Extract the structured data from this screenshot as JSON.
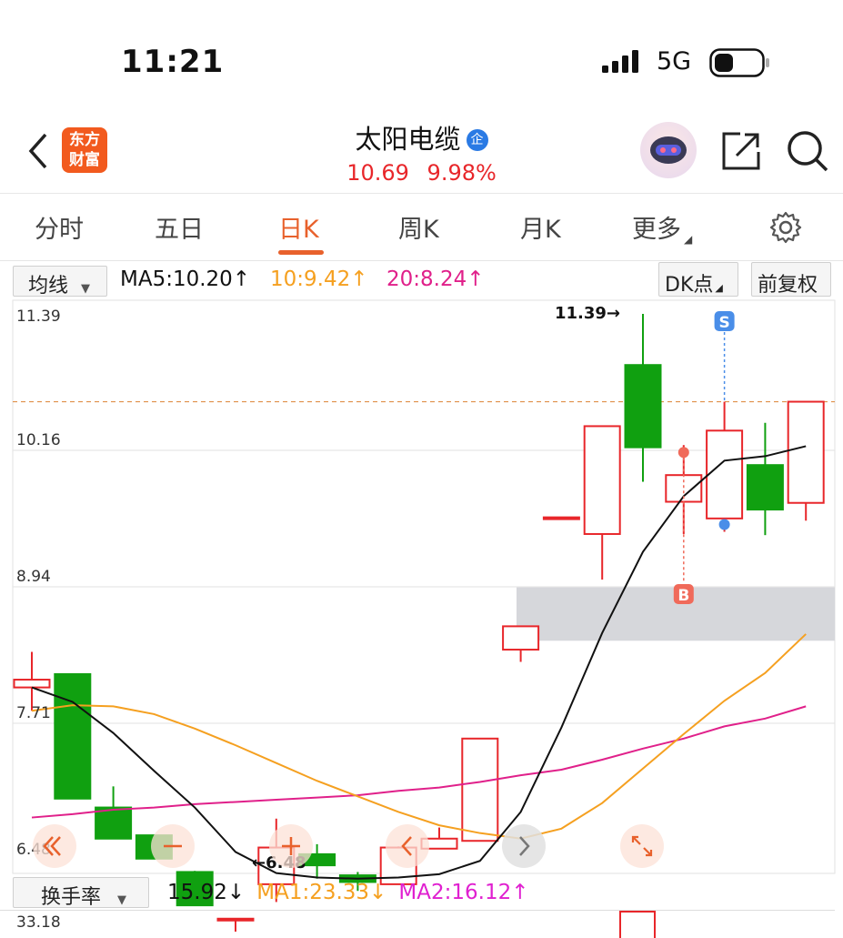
{
  "status": {
    "time": "11:21",
    "network": "5G"
  },
  "header": {
    "logo": [
      "东方",
      "财富"
    ],
    "title": "太阳电缆",
    "title_badge": "企",
    "price": "10.69",
    "change": "9.98%"
  },
  "tabs": [
    {
      "label": "分时"
    },
    {
      "label": "五日"
    },
    {
      "label": "日K",
      "active": true
    },
    {
      "label": "周K"
    },
    {
      "label": "月K"
    },
    {
      "label": "更多"
    }
  ],
  "indicator_bar": {
    "selector": "均线",
    "ma5": "MA5:10.20",
    "ma10": "10:9.42",
    "ma20": "20:8.24",
    "dk_button": "DK点",
    "adjust_button": "前复权"
  },
  "colors": {
    "up": "#e8262a",
    "down": "#10a010",
    "ma5": "#111111",
    "ma10": "#f5a020",
    "ma20": "#e0208a",
    "accent": "#e8612c"
  },
  "chart_data": {
    "type": "candlestick",
    "y_ticks": [
      "11.39",
      "10.16",
      "8.94",
      "7.71",
      "6.48"
    ],
    "ylim": [
      6.48,
      11.39
    ],
    "max_label": "11.39→",
    "min_label": "←6.48",
    "reference_line": 10.6,
    "support_zone": [
      8.45,
      8.93
    ],
    "candles": [
      {
        "o": 8.03,
        "c": 8.1,
        "h": 8.35,
        "l": 7.82
      },
      {
        "o": 8.15,
        "c": 7.03,
        "h": 8.15,
        "l": 7.03
      },
      {
        "o": 6.95,
        "c": 6.67,
        "h": 7.14,
        "l": 6.67
      },
      {
        "o": 6.7,
        "c": 6.49,
        "h": 6.7,
        "l": 6.49
      },
      {
        "o": 6.37,
        "c": 6.07,
        "h": 6.38,
        "l": 6.07
      },
      {
        "o": 5.95,
        "c": 5.95,
        "h": 5.95,
        "l": 5.78
      },
      {
        "o": 6.26,
        "c": 6.59,
        "h": 6.85,
        "l": 6.1
      },
      {
        "o": 6.53,
        "c": 6.43,
        "h": 6.62,
        "l": 6.31
      },
      {
        "o": 6.34,
        "c": 6.28,
        "h": 6.37,
        "l": 6.2
      },
      {
        "o": 6.26,
        "c": 6.59,
        "h": 6.6,
        "l": 6.26
      },
      {
        "o": 6.58,
        "c": 6.67,
        "h": 6.77,
        "l": 6.58
      },
      {
        "o": 6.65,
        "c": 7.57,
        "h": 7.57,
        "l": 6.65
      },
      {
        "o": 8.37,
        "c": 8.58,
        "h": 8.58,
        "l": 8.26
      },
      {
        "o": 9.56,
        "c": 9.56,
        "h": 9.56,
        "l": 9.56
      },
      {
        "o": 9.41,
        "c": 10.38,
        "h": 10.38,
        "l": 9.0
      },
      {
        "o": 10.93,
        "c": 10.19,
        "h": 11.39,
        "l": 9.88
      },
      {
        "o": 9.7,
        "c": 9.94,
        "h": 10.21,
        "l": 9.41
      },
      {
        "o": 9.55,
        "c": 10.34,
        "h": 10.6,
        "l": 9.43
      },
      {
        "o": 10.03,
        "c": 9.63,
        "h": 10.41,
        "l": 9.4
      },
      {
        "o": 9.69,
        "c": 10.6,
        "h": 10.6,
        "l": 9.53
      }
    ],
    "ma5": [
      8.03,
      7.9,
      7.62,
      7.28,
      6.95,
      6.55,
      6.36,
      6.32,
      6.31,
      6.32,
      6.35,
      6.47,
      6.91,
      7.67,
      8.52,
      9.25,
      9.75,
      10.07,
      10.11,
      10.2
    ],
    "ma10": [
      7.82,
      7.87,
      7.86,
      7.79,
      7.66,
      7.51,
      7.35,
      7.19,
      7.05,
      6.91,
      6.79,
      6.72,
      6.67,
      6.76,
      6.99,
      7.3,
      7.61,
      7.91,
      8.16,
      8.51
    ],
    "ma20": [
      6.86,
      6.89,
      6.93,
      6.95,
      6.98,
      7.0,
      7.02,
      7.04,
      7.06,
      7.1,
      7.13,
      7.18,
      7.24,
      7.29,
      7.38,
      7.48,
      7.57,
      7.68,
      7.75,
      7.86
    ],
    "markers": [
      {
        "label": "S",
        "candle": 17
      },
      {
        "label": "B",
        "candle": 16
      }
    ]
  },
  "lower_panel": {
    "selector": "换手率",
    "value": "15.92",
    "ma1": "MA1:23.33",
    "ma2": "MA2:16.12",
    "top_tick": "33.18"
  }
}
